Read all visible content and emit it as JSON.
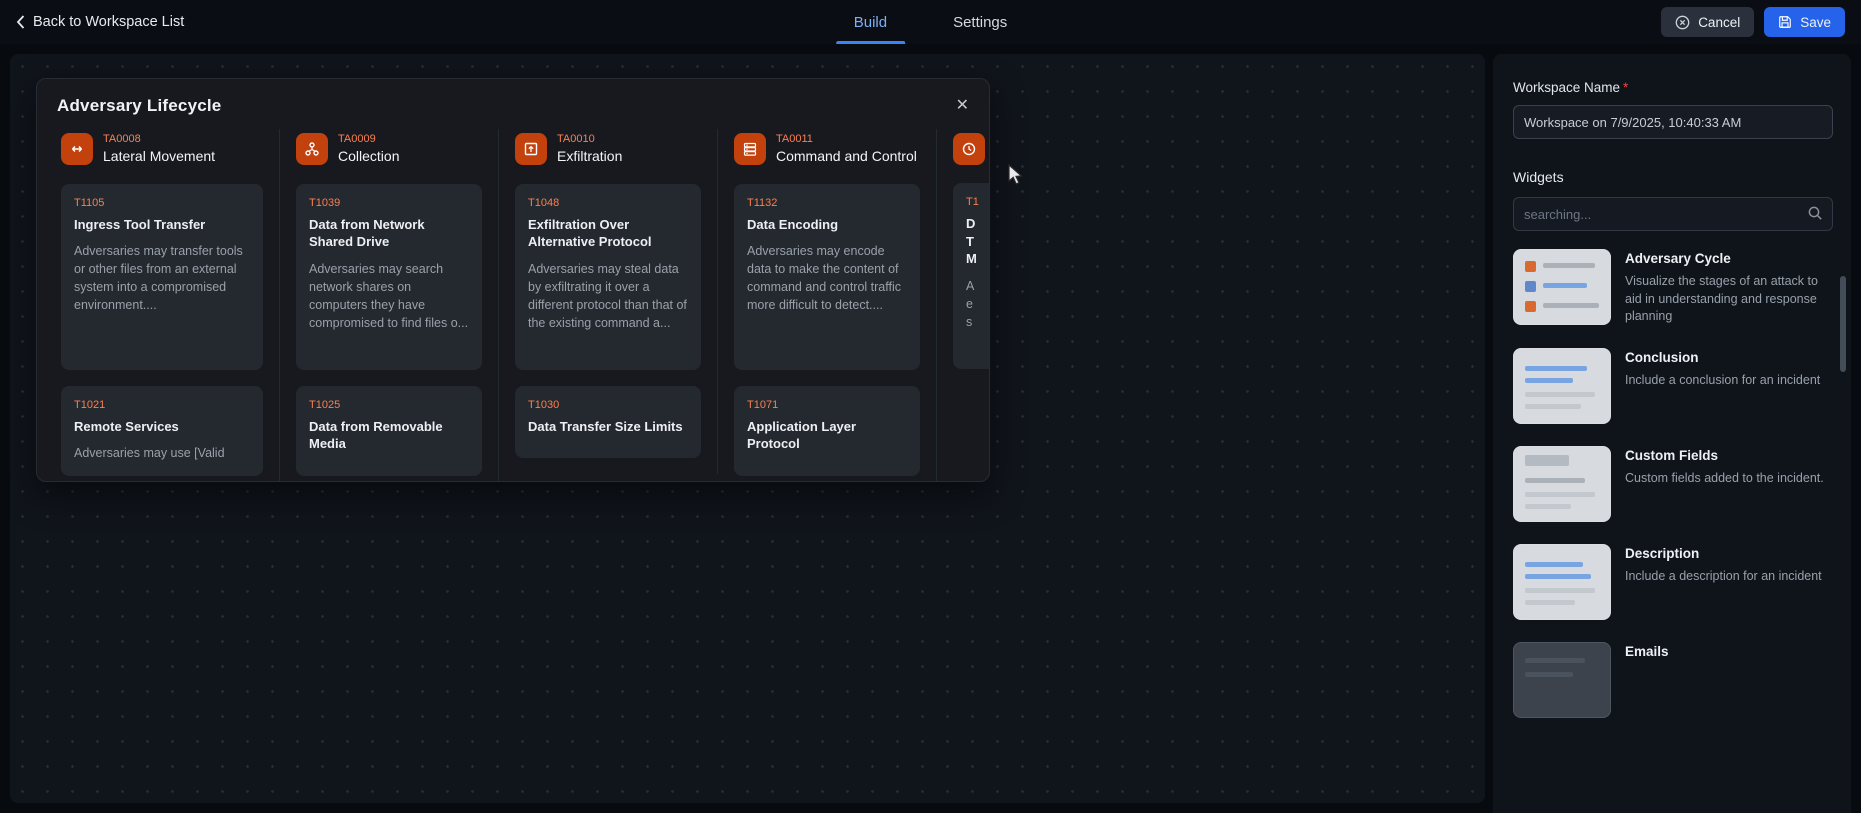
{
  "header": {
    "back_label": "Back to Workspace List",
    "tabs": [
      {
        "label": "Build",
        "active": true
      },
      {
        "label": "Settings",
        "active": false
      }
    ],
    "cancel_label": "Cancel",
    "save_label": "Save"
  },
  "panel": {
    "title": "Adversary Lifecycle",
    "close_glyph": "✕",
    "columns": [
      {
        "tactic_id": "TA0008",
        "tactic_name": "Lateral Movement",
        "icon": "lateral-movement-icon",
        "techniques": [
          {
            "id": "T1105",
            "name": "Ingress Tool Transfer",
            "description": "Adversaries may transfer tools or other files from an external system into a compromised environment...."
          },
          {
            "id": "T1021",
            "name": "Remote Services",
            "description": "Adversaries may use [Valid"
          }
        ]
      },
      {
        "tactic_id": "TA0009",
        "tactic_name": "Collection",
        "icon": "collection-icon",
        "techniques": [
          {
            "id": "T1039",
            "name": "Data from Network Shared Drive",
            "description": "Adversaries may search network shares on computers they have compromised to find files o..."
          },
          {
            "id": "T1025",
            "name": "Data from Removable Media",
            "description": ""
          }
        ]
      },
      {
        "tactic_id": "TA0010",
        "tactic_name": "Exfiltration",
        "icon": "exfiltration-icon",
        "techniques": [
          {
            "id": "T1048",
            "name": "Exfiltration Over Alternative Protocol",
            "description": "Adversaries may steal data by exfiltrating it over a different protocol than that of the existing command a..."
          },
          {
            "id": "T1030",
            "name": "Data Transfer Size Limits",
            "description": ""
          }
        ]
      },
      {
        "tactic_id": "TA0011",
        "tactic_name": "Command and Control",
        "icon": "command-control-icon",
        "techniques": [
          {
            "id": "T1132",
            "name": "Data Encoding",
            "description": "Adversaries may encode data to make the content of command and control traffic more difficult to detect...."
          },
          {
            "id": "T1071",
            "name": "Application Layer Protocol",
            "description": ""
          }
        ]
      }
    ],
    "partial_column": {
      "technique_id": "T1",
      "name_lines": [
        "D",
        "T",
        "M"
      ],
      "desc_lines": [
        "A",
        "e",
        "s"
      ]
    }
  },
  "sidebar": {
    "workspace_name_label": "Workspace Name",
    "required_marker": "*",
    "workspace_name_value": "Workspace on 7/9/2025, 10:40:33 AM",
    "widgets_label": "Widgets",
    "search_placeholder": "searching...",
    "widgets": [
      {
        "title": "Adversary Cycle",
        "description": "Visualize the stages of an attack to aid in understanding and response planning"
      },
      {
        "title": "Conclusion",
        "description": "Include a conclusion for an incident"
      },
      {
        "title": "Custom Fields",
        "description": "Custom fields added to the incident."
      },
      {
        "title": "Description",
        "description": "Include a description for an incident"
      },
      {
        "title": "Emails",
        "description": ""
      }
    ]
  },
  "colors": {
    "accent_blue": "#2563eb",
    "active_tab_blue": "#7ab0f5",
    "tactic_orange": "#c2410c",
    "technique_id_orange": "#fa8050",
    "required_red": "#ef4444"
  }
}
